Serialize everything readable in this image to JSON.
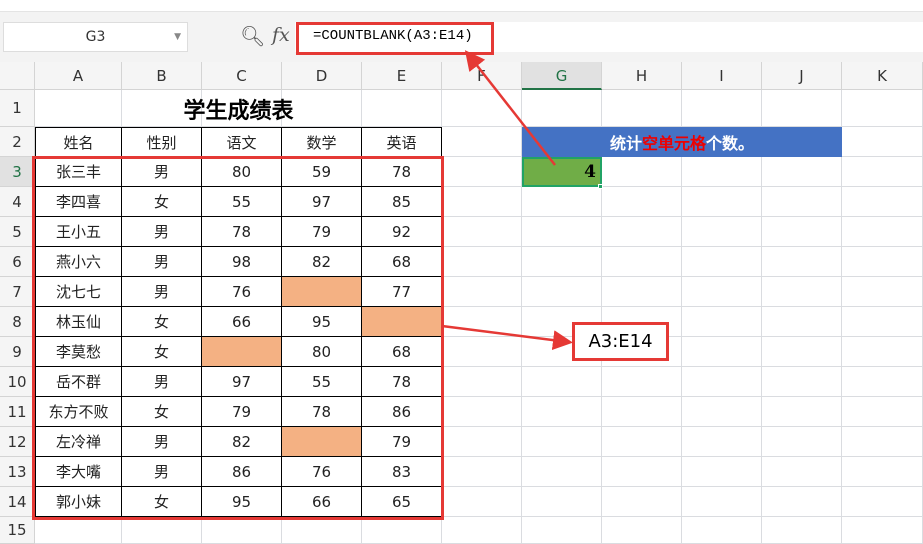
{
  "name_box": "G3",
  "formula": "=COUNTBLANK(A3:E14)",
  "columns": [
    "A",
    "B",
    "C",
    "D",
    "E",
    "F",
    "G",
    "H",
    "I",
    "J",
    "K"
  ],
  "row_numbers": [
    "1",
    "2",
    "3",
    "4",
    "5",
    "6",
    "7",
    "8",
    "9",
    "10",
    "11",
    "12",
    "13",
    "14",
    "15"
  ],
  "table_title": "学生成绩表",
  "headers": [
    "姓名",
    "性别",
    "语文",
    "数学",
    "英语"
  ],
  "rows": [
    [
      "张三丰",
      "男",
      "80",
      "59",
      "78"
    ],
    [
      "李四喜",
      "女",
      "55",
      "97",
      "85"
    ],
    [
      "王小五",
      "男",
      "78",
      "79",
      "92"
    ],
    [
      "燕小六",
      "男",
      "98",
      "82",
      "68"
    ],
    [
      "沈七七",
      "男",
      "76",
      "",
      "77"
    ],
    [
      "林玉仙",
      "女",
      "66",
      "95",
      ""
    ],
    [
      "李莫愁",
      "女",
      "",
      "80",
      "68"
    ],
    [
      "岳不群",
      "男",
      "97",
      "55",
      "78"
    ],
    [
      "东方不败",
      "女",
      "79",
      "78",
      "86"
    ],
    [
      "左冷禅",
      "男",
      "82",
      "",
      "79"
    ],
    [
      "李大嘴",
      "男",
      "86",
      "76",
      "83"
    ],
    [
      "郭小妹",
      "女",
      "95",
      "66",
      "65"
    ]
  ],
  "banner": {
    "part1": "统计",
    "part2": "空单元格",
    "part3": "个数。"
  },
  "result": "4",
  "callout": "A3:E14",
  "colors": {
    "blank": "#f4b183",
    "banner": "#4472c4",
    "result": "#70ad47",
    "annotation": "#e53935"
  }
}
